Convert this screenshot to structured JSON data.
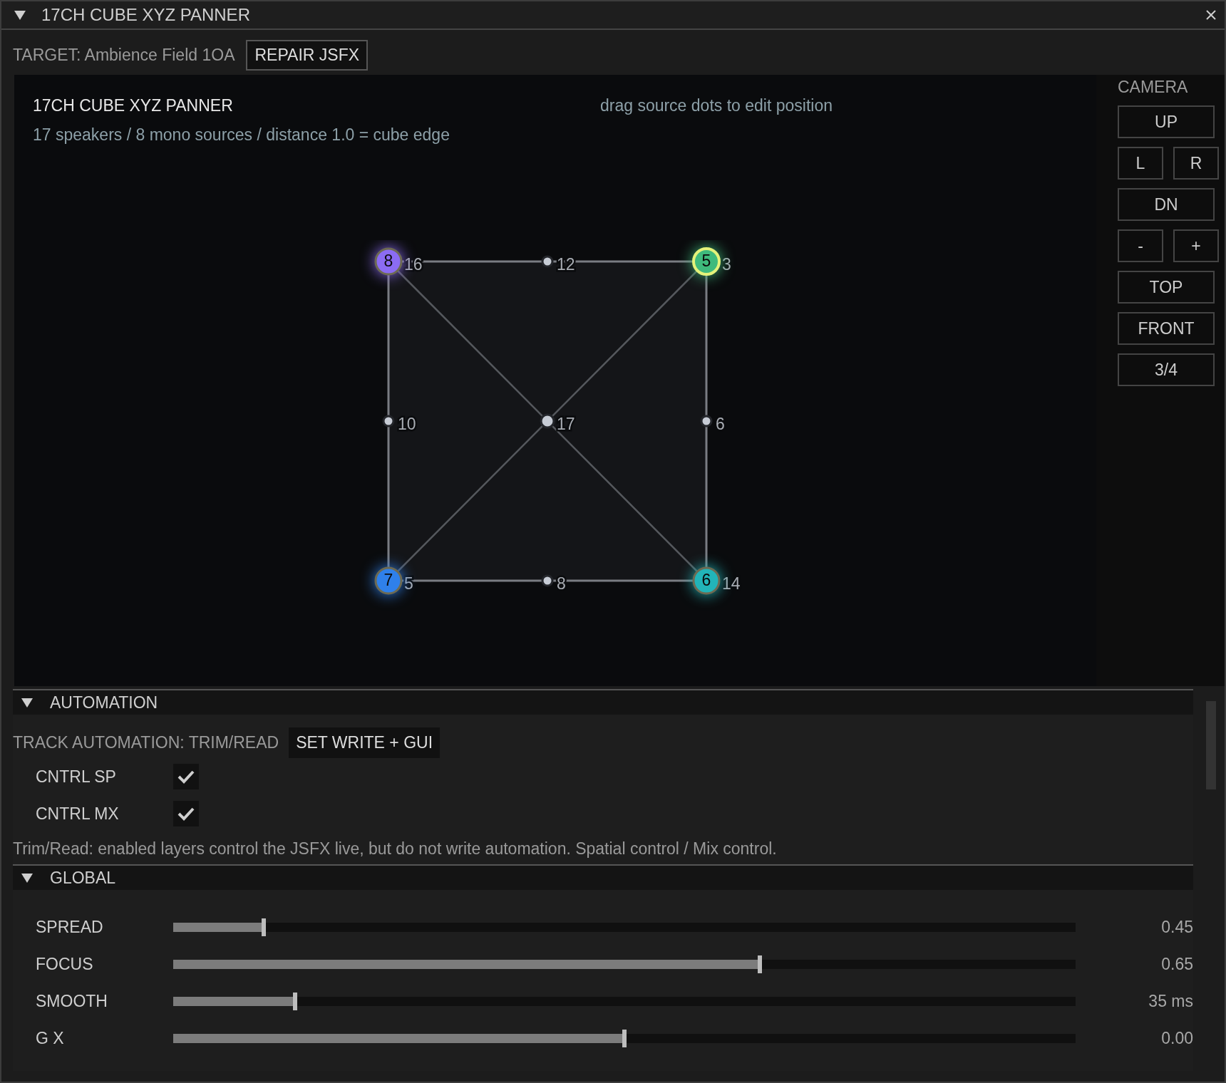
{
  "window": {
    "title": "17CH CUBE XYZ PANNER",
    "expanded": true
  },
  "target": {
    "label": "TARGET: Ambience Field 1OA",
    "button": "REPAIR JSFX"
  },
  "viewport": {
    "title": "17CH CUBE XYZ PANNER",
    "subtitle": "17 speakers / 8 mono sources / distance 1.0 = cube edge",
    "hint": "drag source dots to edit position",
    "speaker_rows": [
      [
        {
          "label": "16",
          "source": {
            "label": "8",
            "color": "#8b6cf2",
            "selected": false
          }
        },
        {
          "label": "12"
        },
        {
          "label": "3",
          "source": {
            "label": "5",
            "color": "#3fba7c",
            "selected": true
          }
        }
      ],
      [
        {
          "label": "10"
        },
        {
          "label": "17"
        },
        {
          "label": "6"
        }
      ],
      [
        {
          "label": "5",
          "source": {
            "label": "7",
            "color": "#2f80ea",
            "selected": false
          }
        },
        {
          "label": "8"
        },
        {
          "label": "14",
          "source": {
            "label": "6",
            "color": "#22b4b8",
            "selected": false
          }
        }
      ]
    ]
  },
  "camera": {
    "title": "CAMERA",
    "rows": [
      [
        "UP"
      ],
      [
        "L",
        "R"
      ],
      [
        "DN"
      ],
      [
        "-",
        "+"
      ],
      [
        "TOP"
      ],
      [
        "FRONT"
      ],
      [
        "3/4"
      ]
    ]
  },
  "automation": {
    "title": "AUTOMATION",
    "expanded": true,
    "status": "TRACK AUTOMATION: TRIM/READ",
    "button": "SET WRITE + GUI",
    "layers": [
      {
        "label": "CNTRL SP",
        "checked": true
      },
      {
        "label": "CNTRL MX",
        "checked": true
      }
    ],
    "help": "Trim/Read: enabled layers control the JSFX live, but do not write automation. Spatial control / Mix control."
  },
  "global": {
    "title": "GLOBAL",
    "expanded": true,
    "sliders": [
      {
        "label": "SPREAD",
        "level": 0.1,
        "reading": "0.45"
      },
      {
        "label": "FOCUS",
        "level": 0.65,
        "reading": "0.65"
      },
      {
        "label": "SMOOTH",
        "level": 0.135,
        "reading": "35 ms"
      },
      {
        "label": "G X",
        "level": 0.5,
        "reading": "0.00"
      }
    ]
  }
}
